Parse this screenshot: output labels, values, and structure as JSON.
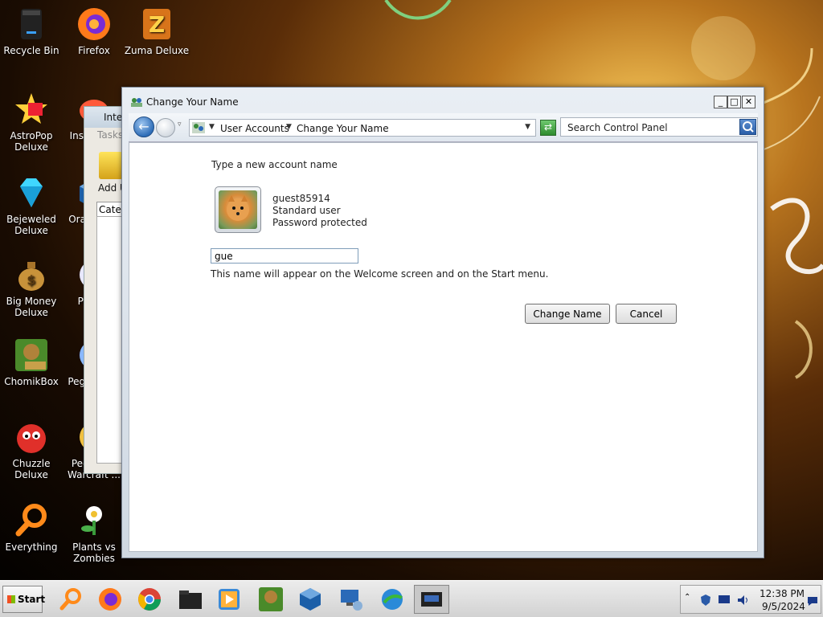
{
  "desktop": {
    "icons": [
      {
        "label": "Recycle Bin",
        "icon": "recycle-bin-icon"
      },
      {
        "label": "Firefox",
        "icon": "firefox-icon"
      },
      {
        "label": "Zuma Deluxe",
        "icon": "zuma-icon"
      },
      {
        "label": "AstroPop Deluxe",
        "icon": "astropop-icon"
      },
      {
        "label": "Insa... D...",
        "icon": "insaniquarium-icon"
      },
      {
        "label": "Bejeweled Deluxe",
        "icon": "bejeweled-icon"
      },
      {
        "label": "Ora... Vir...",
        "icon": "virtualbox-icon"
      },
      {
        "label": "Big Money Deluxe",
        "icon": "money-bag-icon"
      },
      {
        "label": "Pegg...",
        "icon": "peggle-icon"
      },
      {
        "label": "ChomikBox",
        "icon": "chomikbox-icon"
      },
      {
        "label": "Pegg... D...",
        "icon": "peggle-icon"
      },
      {
        "label": "Chuzzle Deluxe",
        "icon": "chuzzle-icon"
      },
      {
        "label": "Pegg... of Warcraft ...",
        "icon": "peggle-icon"
      },
      {
        "label": "Everything",
        "icon": "search-magnifier-icon"
      },
      {
        "label": "Plants vs Zombies",
        "icon": "plants-vs-zombies-icon"
      }
    ]
  },
  "background_window": {
    "title": "Inte",
    "tasks": "Tasks",
    "add": "Add U",
    "categ": "Categ"
  },
  "window": {
    "title": "Change Your Name",
    "minimize": "_",
    "maximize": "□",
    "close": "✕",
    "breadcrumb": [
      "User Accounts",
      "Change Your Name"
    ],
    "search_placeholder": "Search Control Panel",
    "heading": "Type a new account name",
    "account": {
      "name": "guest85914",
      "type": "Standard user",
      "status": "Password protected"
    },
    "name_input_value": "gue",
    "hint": "This name will appear on the Welcome screen and on the Start menu.",
    "change_button": "Change Name",
    "cancel_button": "Cancel"
  },
  "taskbar": {
    "start_label": "Start",
    "apps": [
      "everything-icon",
      "firefox-icon",
      "chrome-icon",
      "folder-icon",
      "media-player-icon",
      "chomikbox-icon",
      "virtualbox-icon",
      "network-icon",
      "internet-download-icon",
      "control-panel-icon"
    ],
    "clock_time": "12:38 PM",
    "clock_date": "9/5/2024"
  },
  "colors": {
    "accent": "#2f6eb8",
    "title_bar": "#dfe6ee"
  }
}
